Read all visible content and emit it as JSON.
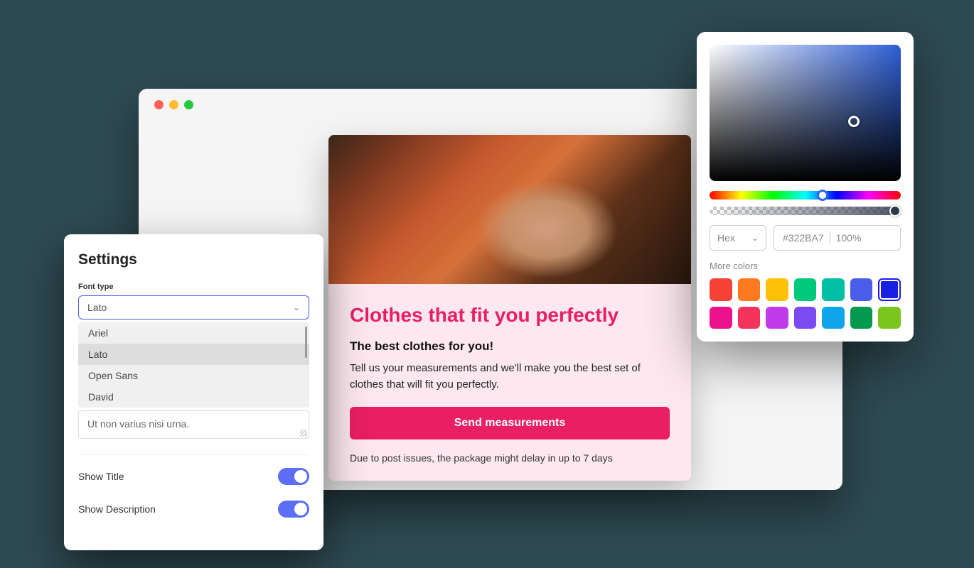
{
  "card": {
    "title": "Clothes that fit you perfectly",
    "subtitle": "The best clothes for you!",
    "body": "Tell us your measurements and we'll make you the best set of clothes that will fit you perfectly.",
    "cta": "Send measurements",
    "note": "Due to post issues, the package might delay in up to 7 days"
  },
  "settings": {
    "title": "Settings",
    "fontLabel": "Font type",
    "selectedFont": "Lato",
    "fonts": [
      "Ariel",
      "Lato",
      "Open Sans",
      "David"
    ],
    "placeholder": "Ut non varius nisi urna.",
    "toggles": [
      {
        "label": "Show Title",
        "on": true
      },
      {
        "label": "Show Description",
        "on": true
      }
    ]
  },
  "colorPicker": {
    "formatLabel": "Hex",
    "hex": "#322BA7",
    "alpha": "100%",
    "moreLabel": "More colors",
    "swatches": [
      {
        "color": "#f44336",
        "sel": false
      },
      {
        "color": "#ff7a1f",
        "sel": false
      },
      {
        "color": "#ffc107",
        "sel": false
      },
      {
        "color": "#00c97b",
        "sel": false
      },
      {
        "color": "#00bfa5",
        "sel": false
      },
      {
        "color": "#4a5de8",
        "sel": false
      },
      {
        "color": "#1720e0",
        "sel": true
      },
      {
        "color": "#ec128d",
        "sel": false
      },
      {
        "color": "#f4335c",
        "sel": false
      },
      {
        "color": "#c13ce9",
        "sel": false
      },
      {
        "color": "#7b4af0",
        "sel": false
      },
      {
        "color": "#0ea5e9",
        "sel": false
      },
      {
        "color": "#059950",
        "sel": false
      },
      {
        "color": "#7bc61e",
        "sel": false
      }
    ]
  }
}
